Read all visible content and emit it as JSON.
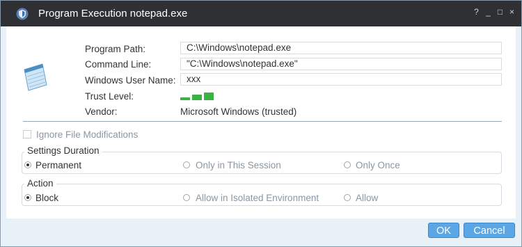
{
  "window": {
    "title": "Program Execution notepad.exe",
    "controls": {
      "help": "?",
      "minimize": "_",
      "maximize": "□",
      "close": "×"
    }
  },
  "info": {
    "program_path_label": "Program Path:",
    "program_path_value": "C:\\Windows\\notepad.exe",
    "command_line_label": "Command Line:",
    "command_line_value": "\"C:\\Windows\\notepad.exe\"",
    "user_name_label": "Windows User Name:",
    "user_name_value": "xxx",
    "trust_level_label": "Trust Level:",
    "trust_level": {
      "filled": 3,
      "total": 3,
      "color": "#3bb244"
    },
    "vendor_label": "Vendor:",
    "vendor_value": "Microsoft Windows (trusted)"
  },
  "ignore_file_modifications": {
    "label": "Ignore File Modifications",
    "checked": false
  },
  "settings_duration": {
    "title": "Settings Duration",
    "options": [
      {
        "label": "Permanent",
        "selected": true
      },
      {
        "label": "Only in This Session",
        "selected": false
      },
      {
        "label": "Only Once",
        "selected": false
      }
    ]
  },
  "action": {
    "title": "Action",
    "options": [
      {
        "label": "Block",
        "selected": true
      },
      {
        "label": "Allow in Isolated Environment",
        "selected": false
      },
      {
        "label": "Allow",
        "selected": false
      }
    ]
  },
  "buttons": {
    "ok": "OK",
    "cancel": "Cancel"
  },
  "colors": {
    "titlebar": "#2e3033",
    "button_fill": "#5aa6e6",
    "button_border": "#3d87c9",
    "text_disabled": "#8a96a3",
    "text_enabled": "#333333"
  }
}
